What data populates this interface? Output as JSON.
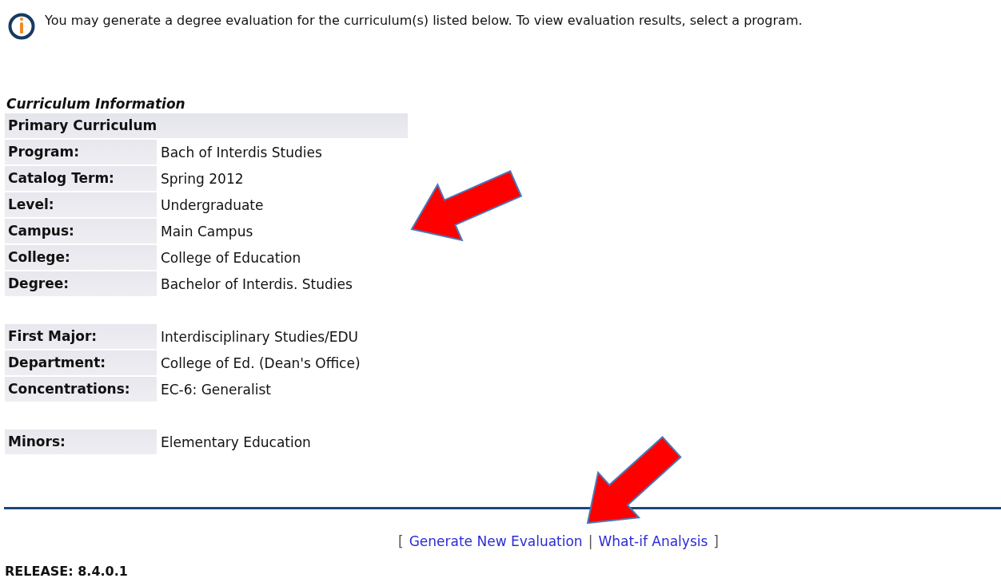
{
  "notice": {
    "text": "You may generate a degree evaluation for the curriculum(s) listed below. To view evaluation results, select a program."
  },
  "curriculum": {
    "heading": "Curriculum Information",
    "section_title": "Primary Curriculum",
    "groups": [
      {
        "rows": [
          {
            "label": "Program:",
            "value": "Bach of Interdis Studies"
          },
          {
            "label": "Catalog Term:",
            "value": "Spring 2012"
          },
          {
            "label": "Level:",
            "value": "Undergraduate"
          },
          {
            "label": "Campus:",
            "value": "Main Campus"
          },
          {
            "label": "College:",
            "value": "College of Education"
          },
          {
            "label": "Degree:",
            "value": "Bachelor of Interdis. Studies"
          }
        ]
      },
      {
        "rows": [
          {
            "label": "First Major:",
            "value": "Interdisciplinary Studies/EDU"
          },
          {
            "label": "Department:",
            "value": "College of Ed. (Dean's Office)"
          },
          {
            "label": "Concentrations:",
            "value": "EC-6: Generalist"
          }
        ]
      },
      {
        "rows": [
          {
            "label": "Minors:",
            "value": "Elementary Education"
          }
        ]
      }
    ]
  },
  "links": {
    "open": "[",
    "items": [
      {
        "label": "Generate New Evaluation"
      },
      {
        "label": "What-if Analysis"
      }
    ],
    "separator": "|",
    "close": "]"
  },
  "release": "RELEASE: 8.4.0.1"
}
